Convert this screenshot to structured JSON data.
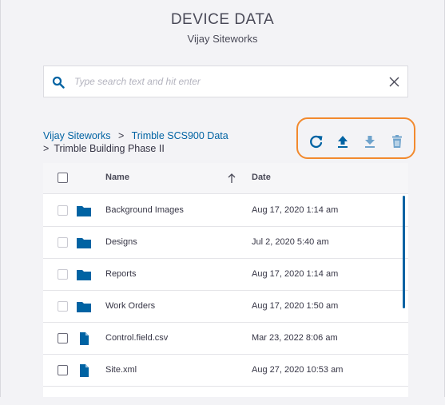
{
  "header": {
    "title": "DEVICE DATA",
    "subtitle": "Vijay Siteworks"
  },
  "search": {
    "placeholder": "Type search text and hit enter",
    "value": "",
    "icon": "search-icon",
    "clear_icon": "close-icon"
  },
  "breadcrumb": {
    "items": [
      "Vijay Siteworks",
      "Trimble SCS900 Data",
      "Trimble Building Phase II"
    ],
    "separator": ">"
  },
  "toolbar": {
    "refresh_icon": "refresh-icon",
    "upload_icon": "upload-icon",
    "download_icon": "download-icon",
    "delete_icon": "trash-icon",
    "highlight_color": "#f28a2e"
  },
  "table": {
    "columns": {
      "name": "Name",
      "date": "Date"
    },
    "sort": "ascending",
    "rows": [
      {
        "type": "folder",
        "name": "Background Images",
        "date": "Aug 17, 2020 1:14 am"
      },
      {
        "type": "folder",
        "name": "Designs",
        "date": "Jul 2, 2020 5:40 am"
      },
      {
        "type": "folder",
        "name": "Reports",
        "date": "Aug 17, 2020 1:14 am"
      },
      {
        "type": "folder",
        "name": "Work Orders",
        "date": "Aug 17, 2020 1:50 am"
      },
      {
        "type": "file",
        "name": "Control.field.csv",
        "date": "Mar 23, 2022 8:06 am"
      },
      {
        "type": "file",
        "name": "Site.xml",
        "date": "Aug 27, 2020 10:53 am"
      }
    ]
  },
  "colors": {
    "accent": "#0063a3",
    "text": "#363545",
    "background": "#f3f3f6"
  }
}
